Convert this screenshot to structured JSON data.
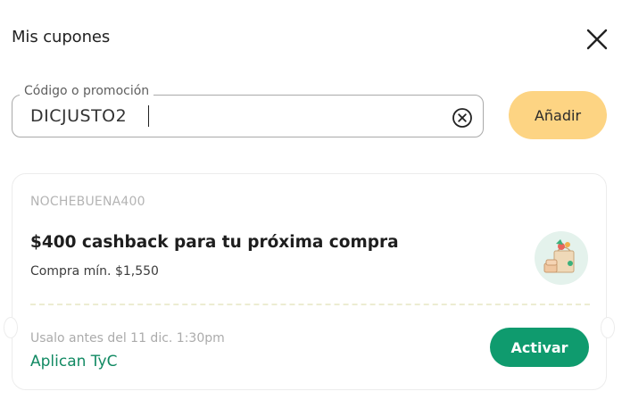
{
  "modal": {
    "title": "Mis cupones",
    "close_icon": "close-icon"
  },
  "coupon_input": {
    "label": "Código o promoción",
    "value": "DICJUSTO2",
    "clear_icon": "clear-circle-x-icon",
    "add_button_label": "Añadir"
  },
  "coupon_card": {
    "code": "NOCHEBUENA400",
    "title": "$400 cashback para tu próxima compra",
    "min_purchase": "Compra mín. $1,550",
    "illustration_icon": "shopping-bag-illustration",
    "expiry": "Usalo antes del 11 dic. 1:30pm",
    "terms_link": "Aplican TyC",
    "activate_button_label": "Activar"
  },
  "colors": {
    "add_button": "#fdd483",
    "activate_button": "#0f9b6e",
    "link": "#128a63",
    "illustration_bg": "#e4f2ec"
  }
}
